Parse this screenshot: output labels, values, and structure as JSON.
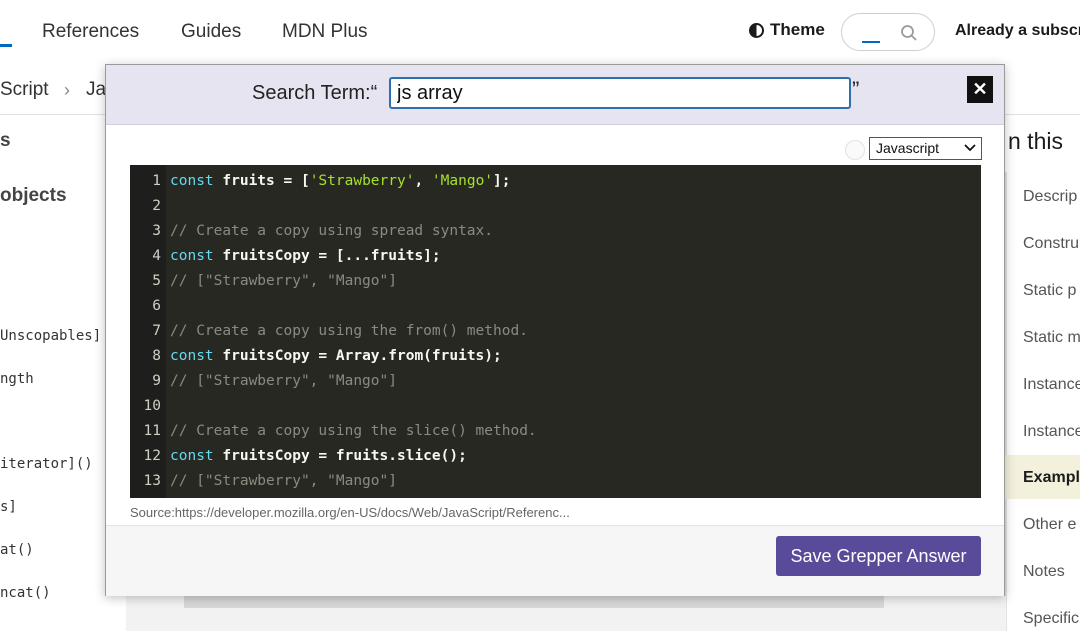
{
  "nav": {
    "links": [
      "References",
      "Guides",
      "MDN Plus"
    ],
    "theme_label": "Theme",
    "subscriber_text": "Already a subscr"
  },
  "breadcrumb": {
    "items": [
      "Script",
      "Ja"
    ]
  },
  "sidebar": {
    "partial_heading_1": "s",
    "partial_heading_2": "objects",
    "items": [
      "Unscopables]",
      "ngth",
      "iterator]()",
      "s]",
      "at()",
      "ncat()"
    ]
  },
  "toc": {
    "title": "n this",
    "items": [
      "Descrip",
      "Constru",
      "Static p",
      "Static m",
      "Instance",
      "Instance",
      "Exampl",
      "Other e",
      "Notes",
      "Specific"
    ]
  },
  "modal": {
    "search_label": "Search Term:“",
    "search_value": "js array",
    "close_quote": "”",
    "close_label": "✕",
    "language": "Javascript",
    "code_lines": [
      {
        "n": "1",
        "kw": "const",
        "id": " fruits",
        "rest": " = [",
        "str1": "'Strawberry'",
        "mid": ", ",
        "str2": "'Mango'",
        "end": "];"
      },
      {
        "n": "2"
      },
      {
        "n": "3",
        "cm": "// Create a copy using spread syntax."
      },
      {
        "n": "4",
        "kw": "const",
        "id": " fruitsCopy",
        "rest": " = [...fruits];"
      },
      {
        "n": "5",
        "cm": "// [\"Strawberry\", \"Mango\"]"
      },
      {
        "n": "6"
      },
      {
        "n": "7",
        "cm": "// Create a copy using the from() method."
      },
      {
        "n": "8",
        "kw": "const",
        "id": " fruitsCopy",
        "rest": " = Array.from(fruits);"
      },
      {
        "n": "9",
        "cm": "// [\"Strawberry\", \"Mango\"]"
      },
      {
        "n": "10"
      },
      {
        "n": "11",
        "cm": "// Create a copy using the slice() method."
      },
      {
        "n": "12",
        "kw": "const",
        "id": " fruitsCopy",
        "rest": " = fruits.slice();"
      },
      {
        "n": "13",
        "cm": "// [\"Strawberry\", \"Mango\"]"
      }
    ],
    "source_text": "Source:https://developer.mozilla.org/en-US/docs/Web/JavaScript/Referenc...",
    "save_label": "Save Grepper Answer"
  },
  "colors": {
    "accent": "#5a4a9a",
    "mdn_blue": "#0069c2",
    "editor_bg": "#272822"
  }
}
